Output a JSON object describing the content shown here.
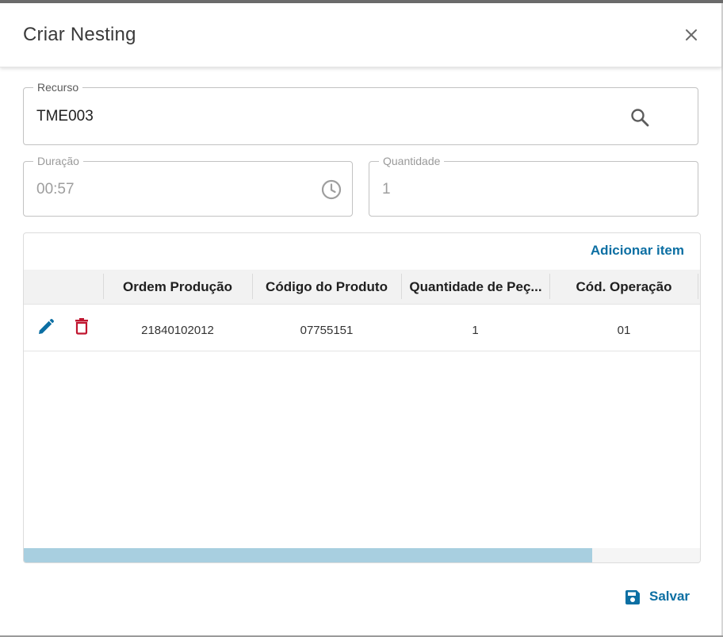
{
  "dialog": {
    "title": "Criar Nesting",
    "close_icon": "close-icon"
  },
  "form": {
    "recurso": {
      "label": "Recurso",
      "value": "TME003",
      "icon": "search-icon"
    },
    "duracao": {
      "label": "Duração",
      "value": "00:57",
      "icon": "clock-icon",
      "disabled": true
    },
    "quantidade": {
      "label": "Quantidade",
      "value": "1",
      "disabled": true
    }
  },
  "grid": {
    "add_label": "Adicionar item",
    "columns": [
      "Ordem Produção",
      "Código do Produto",
      "Quantidade de Peç...",
      "Cód. Operação"
    ],
    "rows": [
      {
        "ordem_producao": "21840102012",
        "codigo_produto": "07755151",
        "quantidade_pecas": "1",
        "cod_operacao": "01",
        "actions": [
          "edit-icon",
          "delete-icon"
        ]
      }
    ],
    "horizontal_scroll_fraction": 0.84
  },
  "footer": {
    "save_label": "Salvar",
    "save_icon": "save-icon"
  },
  "colors": {
    "accent": "#0c6fa3",
    "delete": "#c0152f",
    "scroll_thumb": "#a8cfe0"
  }
}
